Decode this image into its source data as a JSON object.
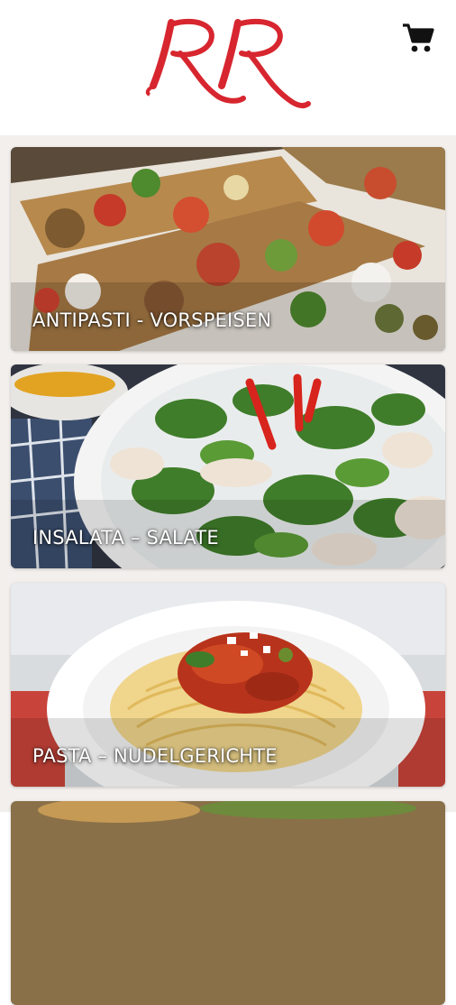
{
  "header": {
    "logo_text": "RR",
    "logo_color": "#d7262f",
    "cart_icon": "shopping-cart-icon"
  },
  "categories": [
    {
      "label": "ANTIPASTI - VORSPEISEN"
    },
    {
      "label": "INSALATA – SALATE"
    },
    {
      "label": "PASTA – NUDELGERICHTE"
    }
  ]
}
